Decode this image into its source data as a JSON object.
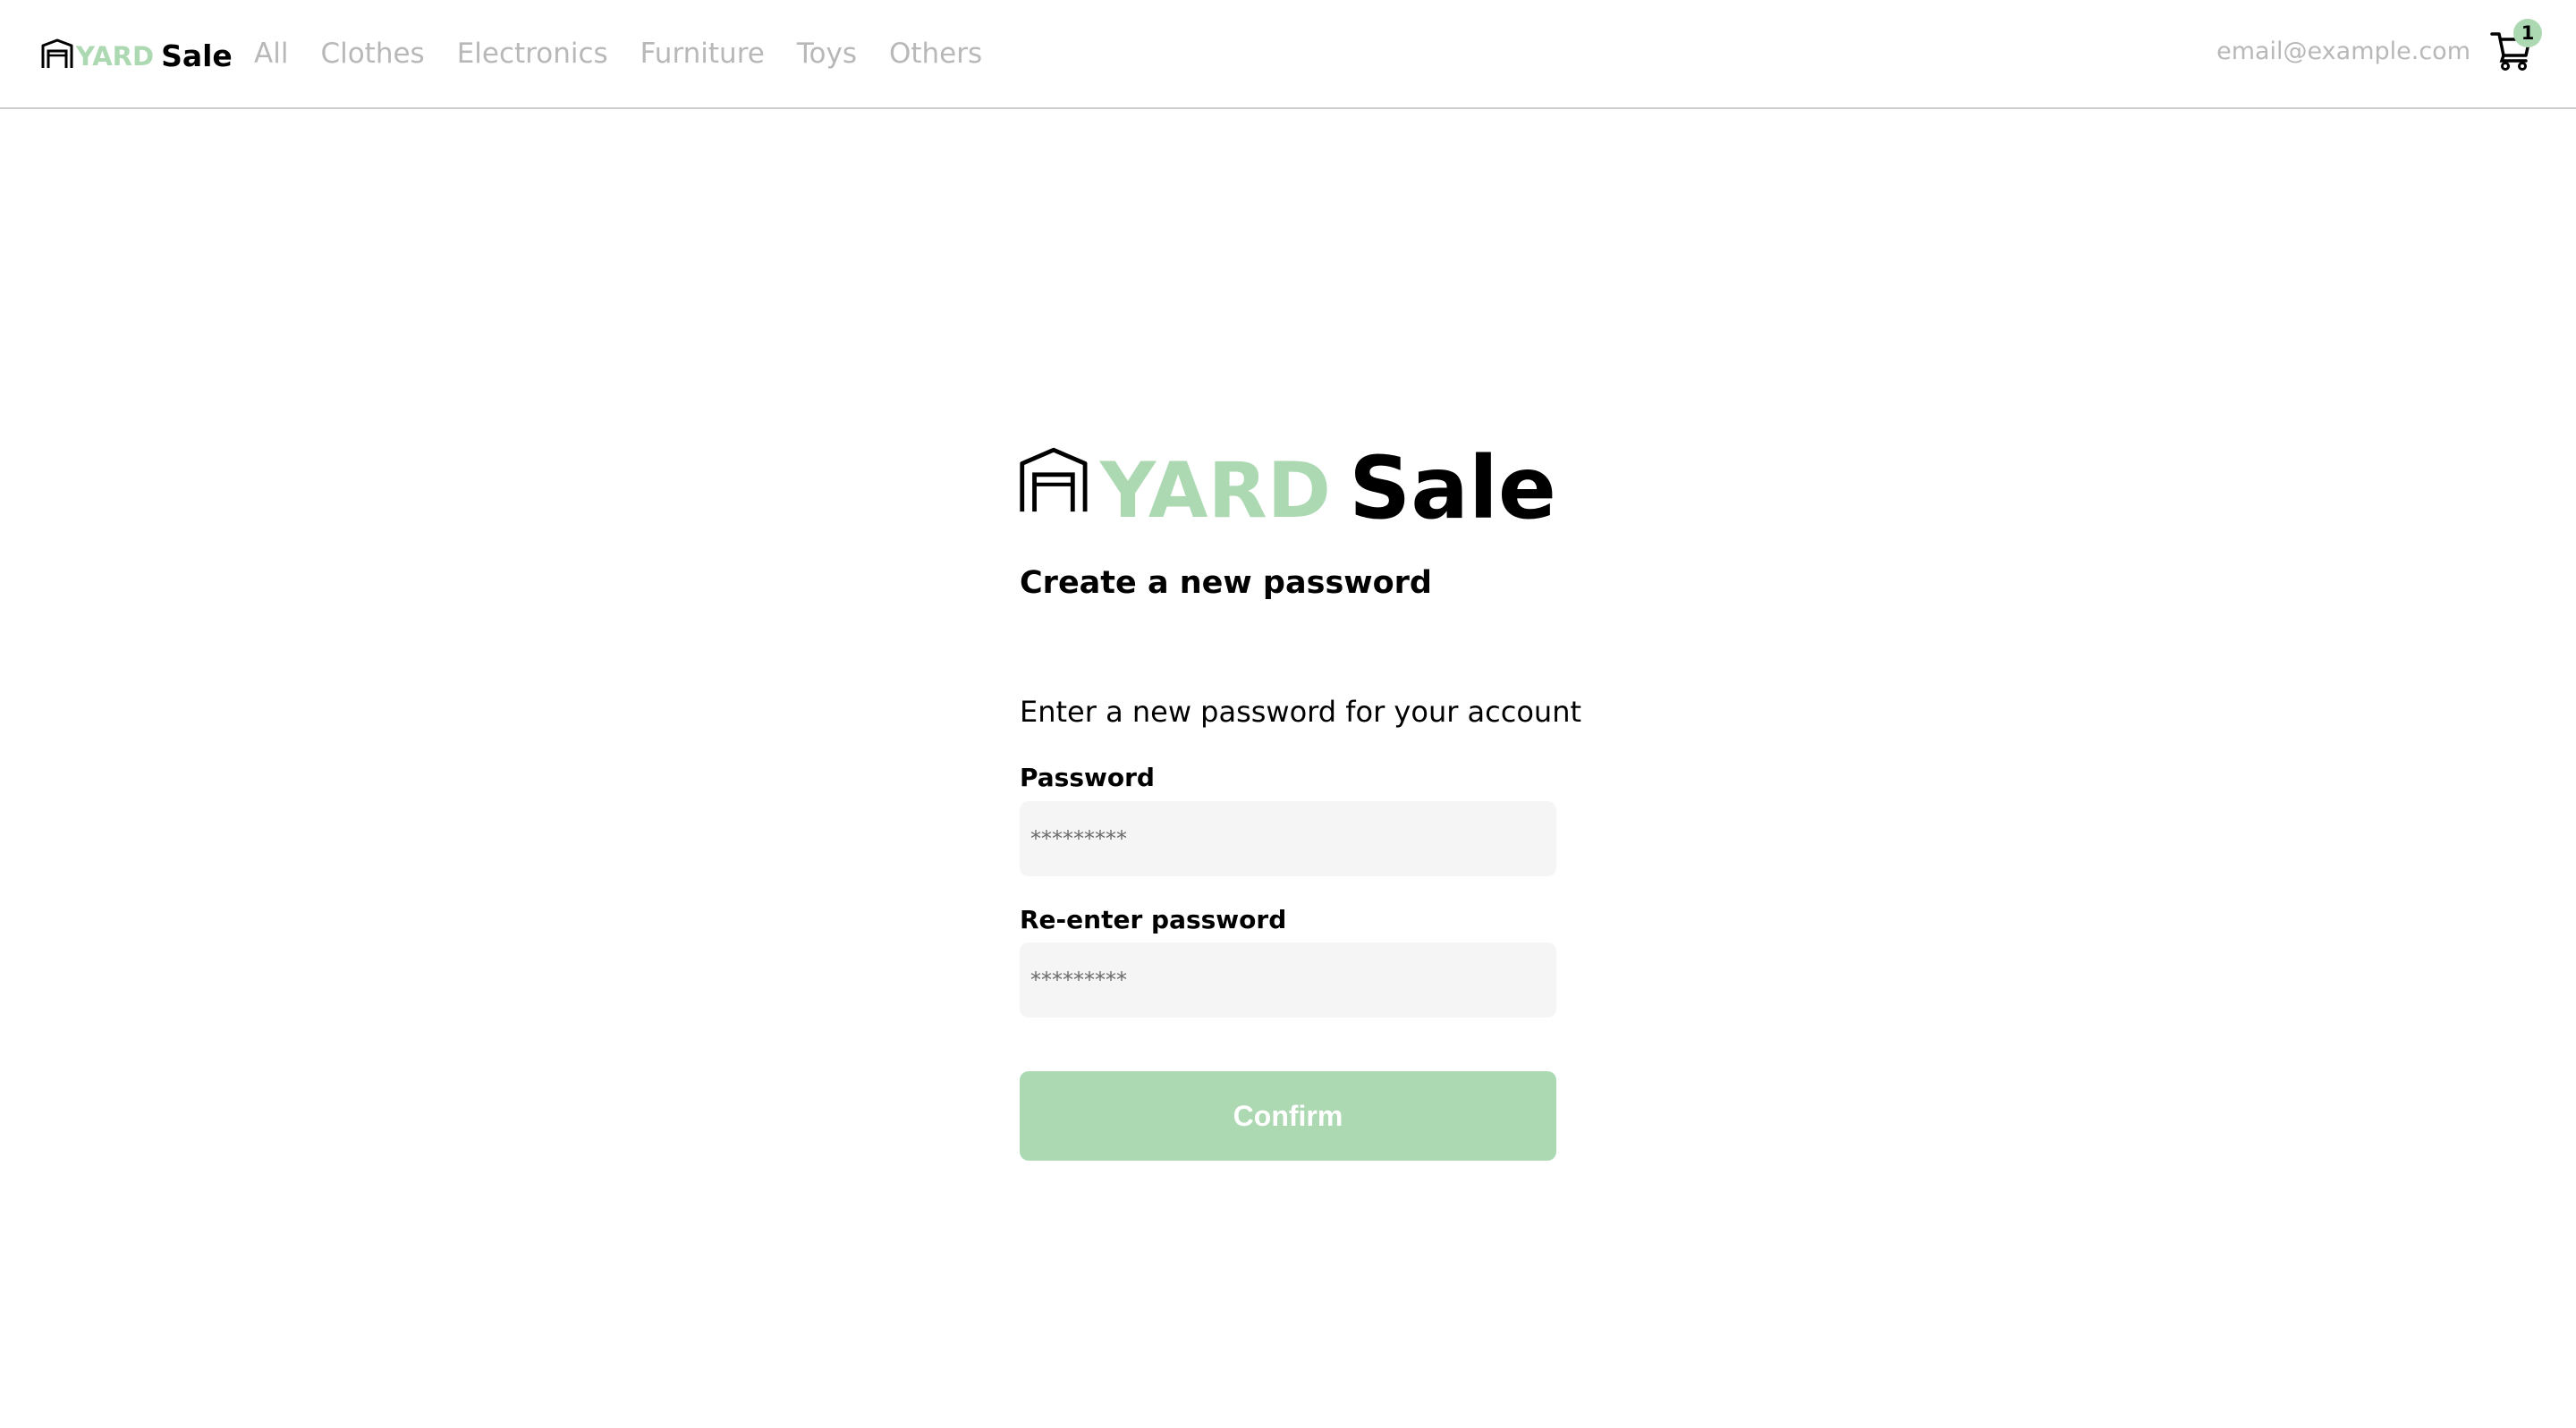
{
  "navbar": {
    "brand": {
      "yard": "YARD",
      "sale": "Sale"
    },
    "links": [
      "All",
      "Clothes",
      "Electronics",
      "Furniture",
      "Toys",
      "Others"
    ],
    "email": "email@example.com",
    "cart": {
      "count": "1",
      "icon": "cart-icon"
    }
  },
  "form": {
    "logo": {
      "yard": "YARD",
      "sale": "Sale",
      "icon": "garage-icon"
    },
    "title": "Create a new password",
    "subtitle": "Enter a new password for your account",
    "password": {
      "label": "Password",
      "placeholder": "*********"
    },
    "reenter": {
      "label": "Re-enter password",
      "placeholder": "*********"
    },
    "confirm_label": "Confirm"
  },
  "colors": {
    "accent": "#acd9b2",
    "muted_text": "#b8b8b8",
    "input_bg": "#f5f5f5"
  }
}
